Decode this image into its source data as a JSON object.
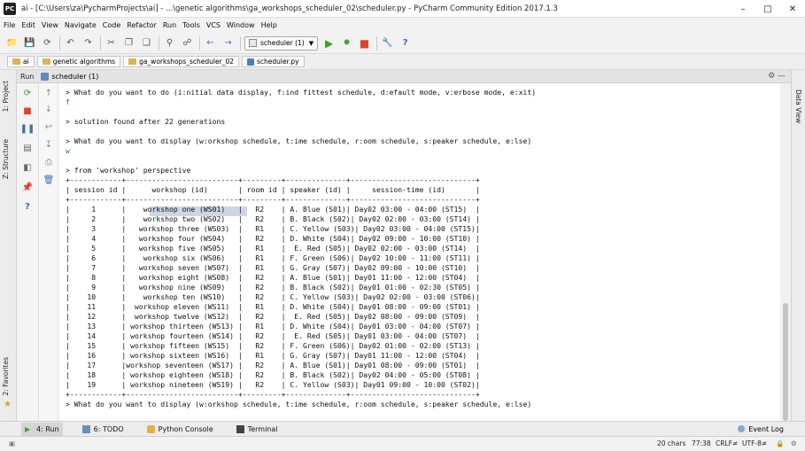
{
  "window": {
    "title": "ai - [C:\\Users\\za\\PycharmProjects\\ai] - ...\\genetic algorithms\\ga_workshops_scheduler_02\\scheduler.py - PyCharm Community Edition 2017.1.3",
    "app_icon": "PC",
    "controls": [
      "–",
      "□",
      "✕"
    ]
  },
  "menu": [
    "File",
    "Edit",
    "View",
    "Navigate",
    "Code",
    "Refactor",
    "Run",
    "Tools",
    "VCS",
    "Window",
    "Help"
  ],
  "toolbar": {
    "run_config": "scheduler (1)",
    "icons": [
      "open-icon",
      "save-icon",
      "sync-icon",
      "undo-icon",
      "redo-icon",
      "cut-icon",
      "copy-icon",
      "paste-icon",
      "find-icon",
      "replace-icon",
      "back-icon",
      "forward-icon"
    ]
  },
  "breadcrumbs": [
    "ai",
    "genetic algorithms",
    "ga_workshops_scheduler_02",
    "scheduler.py"
  ],
  "left_tabs": {
    "project": "1: Project",
    "structure": "Z: Structure",
    "favorites": "2: Favorites"
  },
  "right_tabs": {
    "data_view": "Data View"
  },
  "run_panel": {
    "label": "Run",
    "tab": "scheduler (1)"
  },
  "console": {
    "lines": [
      {
        "text": "> What do you want to do (i:nitial data display, f:ind fittest schedule, d:efault mode, v:erbose mode, e:xit)",
        "kind": "out"
      },
      {
        "text": "f",
        "kind": "in"
      },
      {
        "text": "",
        "kind": "out"
      },
      {
        "text": "> solution found after 22 generations",
        "kind": "out"
      },
      {
        "text": "",
        "kind": "out"
      },
      {
        "text": "> What do you want to display (w:orkshop schedule, t:ime schedule, r:oom schedule, s:peaker schedule, e:lse)",
        "kind": "out"
      },
      {
        "text": "w",
        "kind": "in"
      },
      {
        "text": "",
        "kind": "out"
      },
      {
        "text": "> from 'workshop' perspective",
        "kind": "out"
      },
      {
        "text": "+------------+--------------------------+---------+--------------+-----------------------------+",
        "kind": "out"
      },
      {
        "text": "| session id |      workshop (id)       | room id | speaker (id) |     session-time (id)       |",
        "kind": "out"
      },
      {
        "text": "+------------+--------------------------+---------+--------------+-----------------------------+",
        "kind": "out"
      },
      {
        "text": "|     1      |    workshop one (WS01)   |   R2    | A. Blue (S01)| Day02 03:00 - 04:00 (ST15)  |",
        "kind": "out"
      },
      {
        "text": "|     2      |    workshop two (WS02)   |   R2    | B. Black (S02)| Day02 02:00 - 03:00 (ST14) |",
        "kind": "out"
      },
      {
        "text": "|     3      |   workshop three (WS03)  |   R1    | C. Yellow (S03)| Day02 03:00 - 04:00 (ST15)|",
        "kind": "out"
      },
      {
        "text": "|     4      |   workshop four (WS04)   |   R2    | D. White (S04)| Day02 09:00 - 10:00 (ST10) |",
        "kind": "out"
      },
      {
        "text": "|     5      |   workshop five (WS05)   |   R1    |  E. Red (S05)| Day02 02:00 - 03:00 (ST14)  |",
        "kind": "out"
      },
      {
        "text": "|     6      |    workshop six (WS06)   |   R1    | F. Green (S06)| Day02 10:00 - 11:00 (ST11) |",
        "kind": "out"
      },
      {
        "text": "|     7      |   workshop seven (WS07)  |   R1    | G. Gray (S07)| Day02 09:00 - 10:00 (ST10)  |",
        "kind": "out"
      },
      {
        "text": "|     8      |   workshop eight (WS08)  |   R2    | A. Blue (S01)| Day01 11:00 - 12:00 (ST04)  |",
        "kind": "out"
      },
      {
        "text": "|     9      |   workshop nine (WS09)   |   R2    | B. Black (S02)| Day01 01:00 - 02:30 (ST05) |",
        "kind": "out"
      },
      {
        "text": "|    10      |    workshop ten (WS10)   |   R2    | C. Yellow (S03)| Day02 02:00 - 03:00 (ST06)|",
        "kind": "out"
      },
      {
        "text": "|    11      |  workshop eleven (WS11)  |   R1    | D. White (S04)| Day01 08:00 - 09:00 (ST01) |",
        "kind": "out"
      },
      {
        "text": "|    12      |  workshop twelve (WS12)  |   R2    |  E. Red (S05)| Day02 08:00 - 09:00 (ST09)  |",
        "kind": "out"
      },
      {
        "text": "|    13      | workshop thirteen (WS13) |   R1    | D. White (S04)| Day01 03:00 - 04:00 (ST07) |",
        "kind": "out"
      },
      {
        "text": "|    14      | workshop fourteen (WS14) |   R2    |  E. Red (S05)| Day01 03:00 - 04:00 (ST07)  |",
        "kind": "out"
      },
      {
        "text": "|    15      | workshop fifteen (WS15)  |   R2    | F. Green (S06)| Day02 01:00 - 02:00 (ST13) |",
        "kind": "out"
      },
      {
        "text": "|    16      | workshop sixteen (WS16)  |   R1    | G. Gray (S07)| Day01 11:00 - 12:00 (ST04)  |",
        "kind": "out"
      },
      {
        "text": "|    17      |workshop seventeen (WS17) |   R2    | A. Blue (S01)| Day01 08:00 - 09:00 (ST01)  |",
        "kind": "out"
      },
      {
        "text": "|    18      | workshop eighteen (WS18) |   R2    | B. Black (S02)| Day02 04:00 - 05:00 (ST08) |",
        "kind": "out"
      },
      {
        "text": "|    19      | workshop nineteen (WS19) |   R2    | C. Yellow (S03)| Day01 09:00 - 10:00 (ST02)|",
        "kind": "out"
      },
      {
        "text": "+------------+--------------------------+---------+--------------+-----------------------------+",
        "kind": "out"
      },
      {
        "text": "> What do you want to display (w:orkshop schedule, t:ime schedule, r:oom schedule, s:peaker schedule, e:lse)",
        "kind": "out"
      }
    ]
  },
  "bottom_tabs": [
    "4: Run",
    "6: TODO",
    "Python Console",
    "Terminal"
  ],
  "event_log": "Event Log",
  "status": {
    "chars": "20 chars",
    "position": "77:38",
    "line_sep": "CRLF≠",
    "encoding": "UTF-8≠"
  },
  "colors": {
    "run_green": "#3aa02a",
    "stop_red": "#d9452b",
    "selection": "#3b6ab5",
    "input_green": "#2e7d32"
  }
}
